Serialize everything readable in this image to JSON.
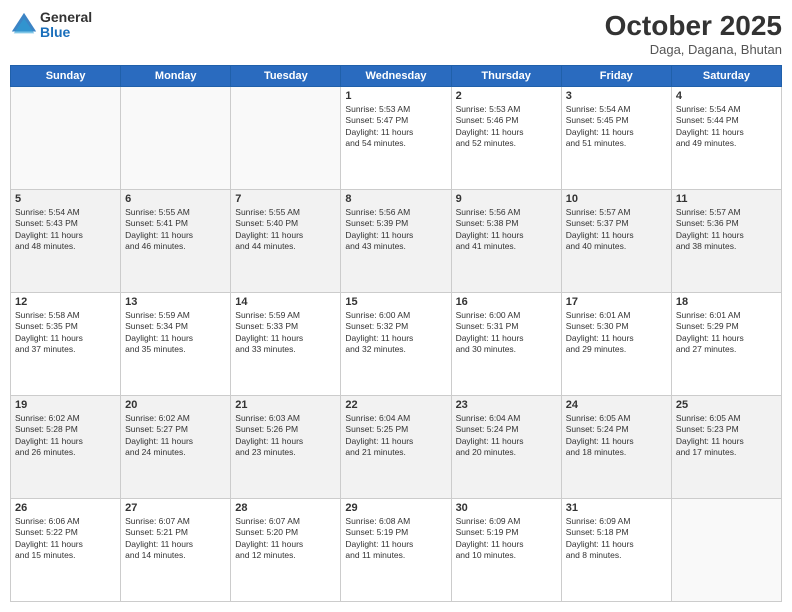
{
  "header": {
    "logo_general": "General",
    "logo_blue": "Blue",
    "month": "October 2025",
    "location": "Daga, Dagana, Bhutan"
  },
  "weekdays": [
    "Sunday",
    "Monday",
    "Tuesday",
    "Wednesday",
    "Thursday",
    "Friday",
    "Saturday"
  ],
  "weeks": [
    [
      {
        "day": "",
        "text": ""
      },
      {
        "day": "",
        "text": ""
      },
      {
        "day": "",
        "text": ""
      },
      {
        "day": "1",
        "text": "Sunrise: 5:53 AM\nSunset: 5:47 PM\nDaylight: 11 hours\nand 54 minutes."
      },
      {
        "day": "2",
        "text": "Sunrise: 5:53 AM\nSunset: 5:46 PM\nDaylight: 11 hours\nand 52 minutes."
      },
      {
        "day": "3",
        "text": "Sunrise: 5:54 AM\nSunset: 5:45 PM\nDaylight: 11 hours\nand 51 minutes."
      },
      {
        "day": "4",
        "text": "Sunrise: 5:54 AM\nSunset: 5:44 PM\nDaylight: 11 hours\nand 49 minutes."
      }
    ],
    [
      {
        "day": "5",
        "text": "Sunrise: 5:54 AM\nSunset: 5:43 PM\nDaylight: 11 hours\nand 48 minutes."
      },
      {
        "day": "6",
        "text": "Sunrise: 5:55 AM\nSunset: 5:41 PM\nDaylight: 11 hours\nand 46 minutes."
      },
      {
        "day": "7",
        "text": "Sunrise: 5:55 AM\nSunset: 5:40 PM\nDaylight: 11 hours\nand 44 minutes."
      },
      {
        "day": "8",
        "text": "Sunrise: 5:56 AM\nSunset: 5:39 PM\nDaylight: 11 hours\nand 43 minutes."
      },
      {
        "day": "9",
        "text": "Sunrise: 5:56 AM\nSunset: 5:38 PM\nDaylight: 11 hours\nand 41 minutes."
      },
      {
        "day": "10",
        "text": "Sunrise: 5:57 AM\nSunset: 5:37 PM\nDaylight: 11 hours\nand 40 minutes."
      },
      {
        "day": "11",
        "text": "Sunrise: 5:57 AM\nSunset: 5:36 PM\nDaylight: 11 hours\nand 38 minutes."
      }
    ],
    [
      {
        "day": "12",
        "text": "Sunrise: 5:58 AM\nSunset: 5:35 PM\nDaylight: 11 hours\nand 37 minutes."
      },
      {
        "day": "13",
        "text": "Sunrise: 5:59 AM\nSunset: 5:34 PM\nDaylight: 11 hours\nand 35 minutes."
      },
      {
        "day": "14",
        "text": "Sunrise: 5:59 AM\nSunset: 5:33 PM\nDaylight: 11 hours\nand 33 minutes."
      },
      {
        "day": "15",
        "text": "Sunrise: 6:00 AM\nSunset: 5:32 PM\nDaylight: 11 hours\nand 32 minutes."
      },
      {
        "day": "16",
        "text": "Sunrise: 6:00 AM\nSunset: 5:31 PM\nDaylight: 11 hours\nand 30 minutes."
      },
      {
        "day": "17",
        "text": "Sunrise: 6:01 AM\nSunset: 5:30 PM\nDaylight: 11 hours\nand 29 minutes."
      },
      {
        "day": "18",
        "text": "Sunrise: 6:01 AM\nSunset: 5:29 PM\nDaylight: 11 hours\nand 27 minutes."
      }
    ],
    [
      {
        "day": "19",
        "text": "Sunrise: 6:02 AM\nSunset: 5:28 PM\nDaylight: 11 hours\nand 26 minutes."
      },
      {
        "day": "20",
        "text": "Sunrise: 6:02 AM\nSunset: 5:27 PM\nDaylight: 11 hours\nand 24 minutes."
      },
      {
        "day": "21",
        "text": "Sunrise: 6:03 AM\nSunset: 5:26 PM\nDaylight: 11 hours\nand 23 minutes."
      },
      {
        "day": "22",
        "text": "Sunrise: 6:04 AM\nSunset: 5:25 PM\nDaylight: 11 hours\nand 21 minutes."
      },
      {
        "day": "23",
        "text": "Sunrise: 6:04 AM\nSunset: 5:24 PM\nDaylight: 11 hours\nand 20 minutes."
      },
      {
        "day": "24",
        "text": "Sunrise: 6:05 AM\nSunset: 5:24 PM\nDaylight: 11 hours\nand 18 minutes."
      },
      {
        "day": "25",
        "text": "Sunrise: 6:05 AM\nSunset: 5:23 PM\nDaylight: 11 hours\nand 17 minutes."
      }
    ],
    [
      {
        "day": "26",
        "text": "Sunrise: 6:06 AM\nSunset: 5:22 PM\nDaylight: 11 hours\nand 15 minutes."
      },
      {
        "day": "27",
        "text": "Sunrise: 6:07 AM\nSunset: 5:21 PM\nDaylight: 11 hours\nand 14 minutes."
      },
      {
        "day": "28",
        "text": "Sunrise: 6:07 AM\nSunset: 5:20 PM\nDaylight: 11 hours\nand 12 minutes."
      },
      {
        "day": "29",
        "text": "Sunrise: 6:08 AM\nSunset: 5:19 PM\nDaylight: 11 hours\nand 11 minutes."
      },
      {
        "day": "30",
        "text": "Sunrise: 6:09 AM\nSunset: 5:19 PM\nDaylight: 11 hours\nand 10 minutes."
      },
      {
        "day": "31",
        "text": "Sunrise: 6:09 AM\nSunset: 5:18 PM\nDaylight: 11 hours\nand 8 minutes."
      },
      {
        "day": "",
        "text": ""
      }
    ]
  ]
}
